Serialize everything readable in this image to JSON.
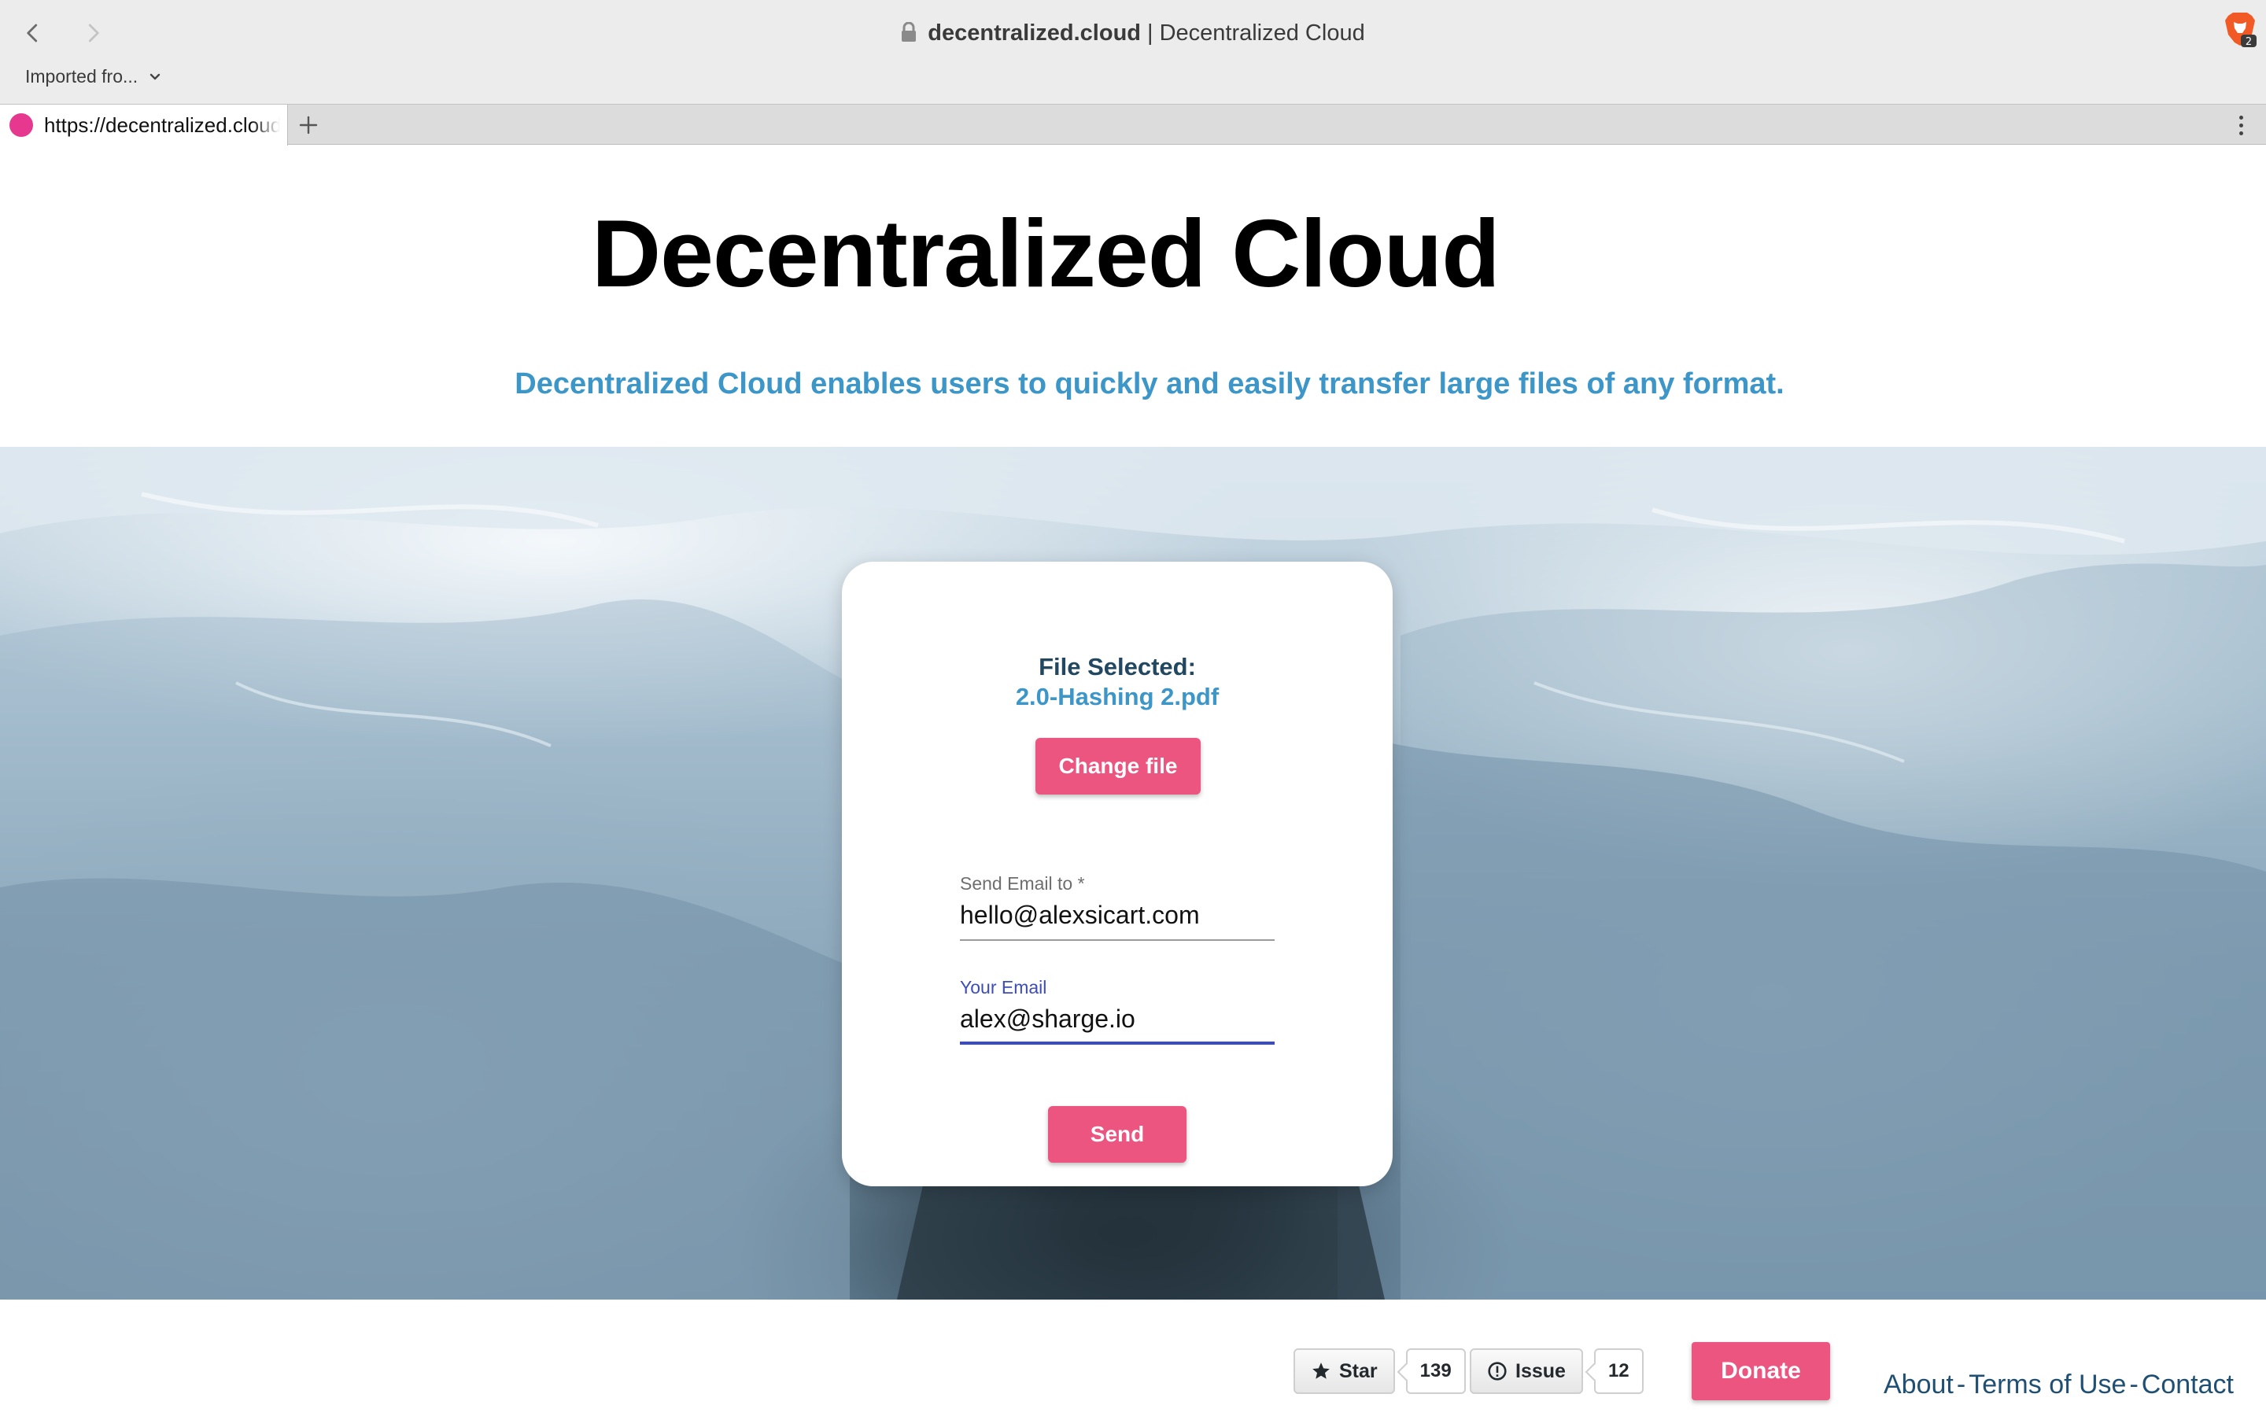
{
  "browser": {
    "address_host": "decentralized.cloud",
    "address_separator": "|",
    "address_title": "Decentralized Cloud",
    "bookmarks_label": "Imported fro...",
    "tab_url": "https://decentralized.cloud",
    "brave_badge": "2",
    "favicon_color": "#e5388e",
    "icons": [
      "back-arrow-icon",
      "forward-arrow-icon",
      "lock-icon",
      "brave-lion-icon",
      "chevron-down-icon",
      "plus-icon",
      "kebab-menu-icon"
    ]
  },
  "header": {
    "title": "Decentralized Cloud",
    "tagline": "Decentralized Cloud enables users to quickly and easily transfer large files of any format."
  },
  "card": {
    "selected_label": "File Selected:",
    "selected_file": "2.0-Hashing 2.pdf",
    "change_file_label": "Change file",
    "send_to_label": "Send Email to *",
    "send_to_value": "hello@alexsicart.com",
    "your_email_label": "Your Email",
    "your_email_value": "alex@sharge.io",
    "send_label": "Send"
  },
  "footer": {
    "star_label": "Star",
    "star_count": "139",
    "issue_label": "Issue",
    "issue_count": "12",
    "donate_label": "Donate",
    "links": [
      "About",
      "Terms of Use",
      "Contact"
    ],
    "link_separator": "-"
  },
  "colors": {
    "accent_pink": "#ec5580",
    "tagline_blue": "#3c96c8",
    "focus_indigo": "#3d4db7",
    "footer_link": "#1f4f73"
  }
}
